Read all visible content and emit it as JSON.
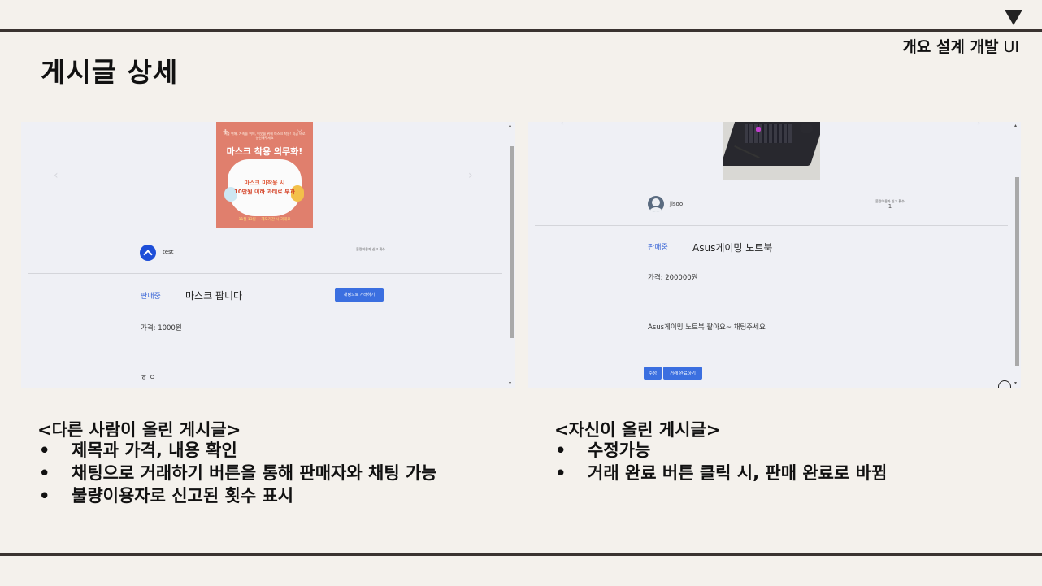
{
  "header": {
    "tag": "개요 설계 개발",
    "ui": "UI"
  },
  "page_title": "게시글 상세",
  "left_screenshot": {
    "poster": {
      "small_text": "나를 위해, 가족을 위해, 이웃을 위해 마스크 착용! 지금 바로 실천해주세요",
      "headline": "마스크 착용 의무화!",
      "mask_line1": "마스크 미착용 시",
      "mask_line2": "10만원 이하 과태료 부과",
      "footer": "11월 13일 ~ 계도기간 시 과태료"
    },
    "username": "test",
    "report_label": "불량이용자 신고 횟수",
    "status": "판매중",
    "title": "마스크 팝니다",
    "chat_button": "채팅으로 거래하기",
    "price": "가격: 1000원",
    "content": "ㅎ ㅇ"
  },
  "right_screenshot": {
    "username": "jisoo",
    "report_label": "불량이용자 신고 횟수",
    "report_count": "1",
    "status": "판매중",
    "title": "Asus게이밍 노트북",
    "price": "가격: 200000원",
    "content": "Asus게이밍 노트북 팔아요~ 채팅주세요",
    "edit_button": "수정",
    "complete_button": "거래 완료하기"
  },
  "left_section": {
    "title": "<다른 사람이 올린 게시글>",
    "bullets": [
      "제목과 가격, 내용 확인",
      "채팅으로 거래하기 버튼을 통해 판매자와 채팅 가능",
      "불량이용자로 신고된 횟수 표시"
    ]
  },
  "right_section": {
    "title": "<자신이 올린 게시글>",
    "bullets": [
      "수정가능",
      "거래 완료 버튼 클릭 시, 판매 완료로 바뀜"
    ]
  }
}
